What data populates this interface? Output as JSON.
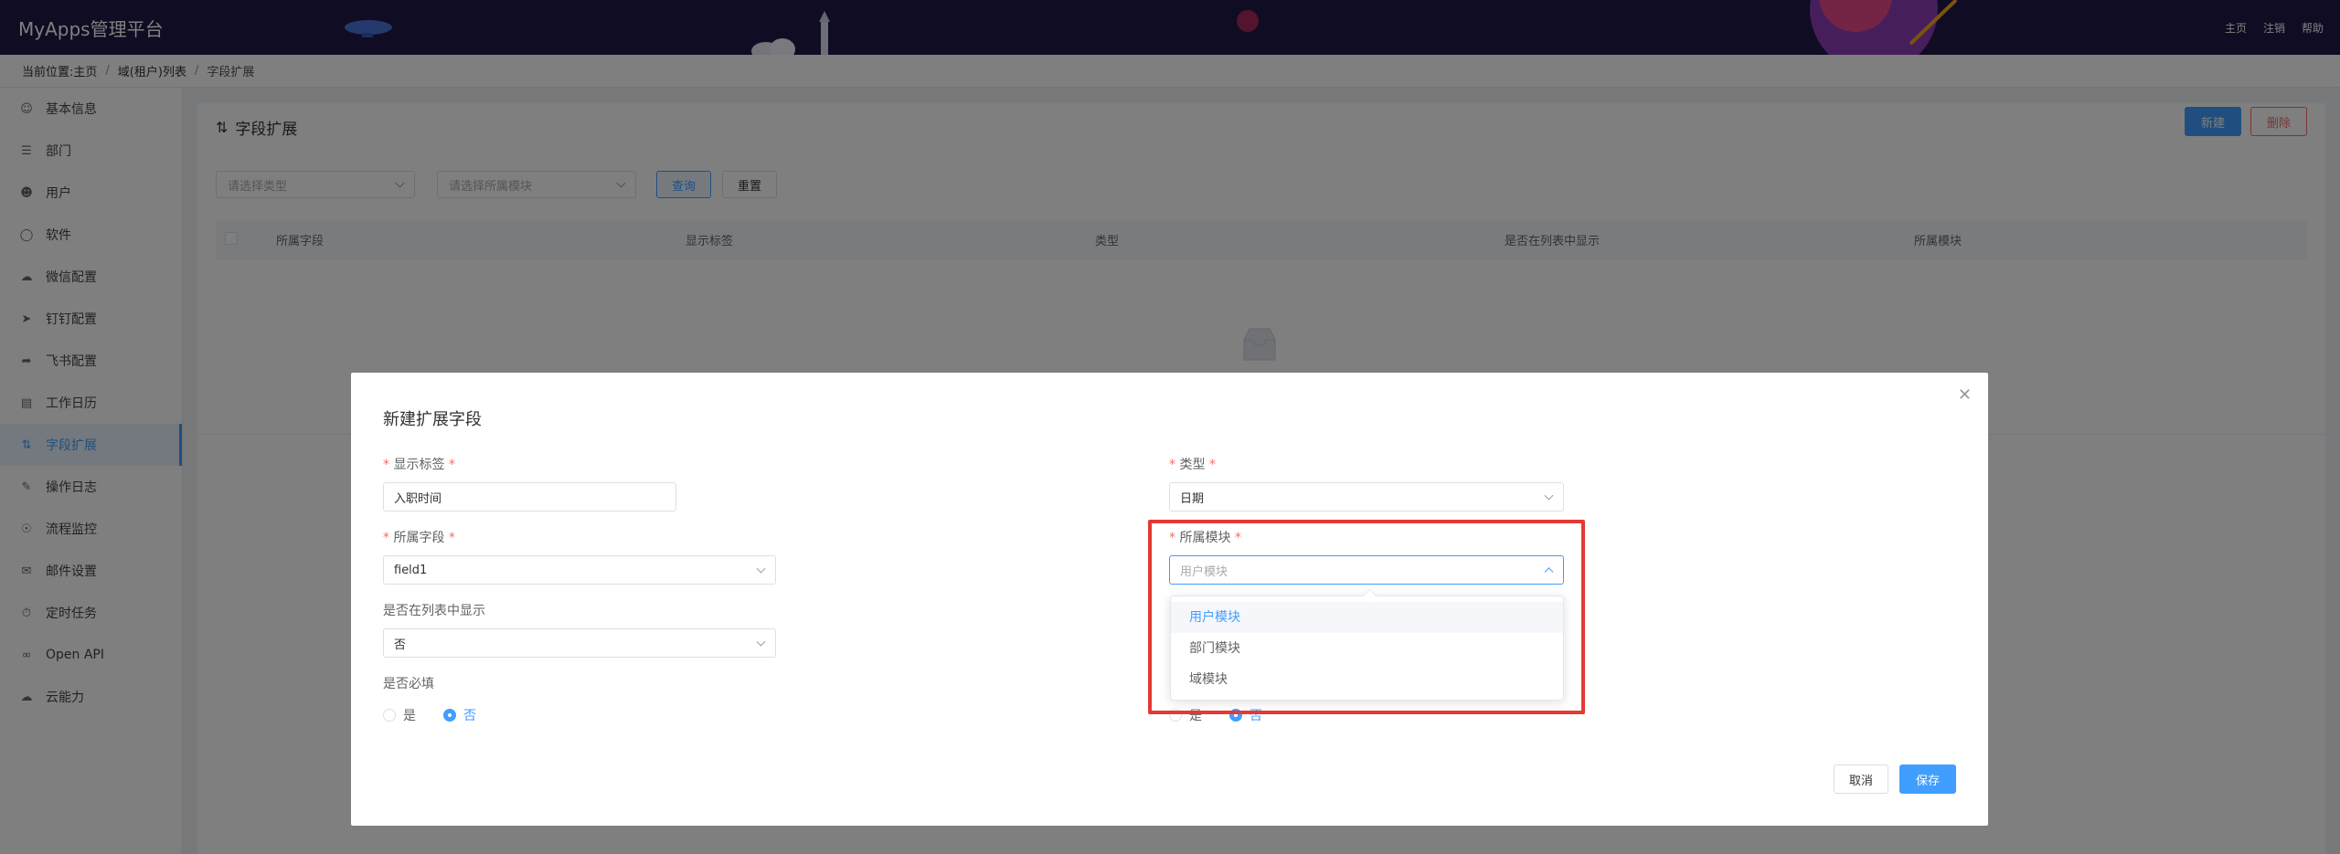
{
  "app": {
    "title": "MyApps管理平台"
  },
  "topnav": {
    "home": "主页",
    "logout": "注销",
    "help": "帮助"
  },
  "breadcrumb": {
    "prefix": "当前位置:",
    "home": "主页",
    "level2": "域(租户)列表",
    "current": "字段扩展"
  },
  "sidebar": {
    "items": [
      {
        "label": "基本信息",
        "icon": "user-icon"
      },
      {
        "label": "部门",
        "icon": "org-icon"
      },
      {
        "label": "用户",
        "icon": "users-icon"
      },
      {
        "label": "软件",
        "icon": "software-icon"
      },
      {
        "label": "微信配置",
        "icon": "wechat-icon"
      },
      {
        "label": "钉钉配置",
        "icon": "dingtalk-icon"
      },
      {
        "label": "飞书配置",
        "icon": "feishu-icon"
      },
      {
        "label": "工作日历",
        "icon": "calendar-icon"
      },
      {
        "label": "字段扩展",
        "icon": "sliders-icon",
        "active": true
      },
      {
        "label": "操作日志",
        "icon": "log-icon"
      },
      {
        "label": "流程监控",
        "icon": "monitor-icon"
      },
      {
        "label": "邮件设置",
        "icon": "mail-icon"
      },
      {
        "label": "定时任务",
        "icon": "timer-icon"
      },
      {
        "label": "Open API",
        "icon": "link-icon"
      },
      {
        "label": "云能力",
        "icon": "cloud-icon"
      }
    ]
  },
  "panel": {
    "title": "字段扩展",
    "new_label": "新建",
    "delete_label": "删除",
    "filter": {
      "type_placeholder": "请选择类型",
      "module_placeholder": "请选择所属模块",
      "query_label": "查询",
      "reset_label": "重置"
    },
    "table": {
      "columns": [
        "所属字段",
        "显示标签",
        "类型",
        "是否在列表中显示",
        "所属模块"
      ]
    }
  },
  "dialog": {
    "title": "新建扩展字段",
    "display_label": {
      "label": "显示标签",
      "value": "入职时间"
    },
    "type": {
      "label": "类型",
      "value": "日期"
    },
    "field": {
      "label": "所属字段",
      "value": "field1"
    },
    "module": {
      "label": "所属模块",
      "placeholder": "用户模块"
    },
    "show_in_list": {
      "label": "是否在列表中显示",
      "value": "否"
    },
    "required": {
      "label": "是否必填",
      "yes": "是",
      "no": "否"
    },
    "right_radio": {
      "yes": "是",
      "no": "否"
    },
    "cancel_label": "取消",
    "save_label": "保存"
  },
  "dropdown": {
    "options": [
      "用户模块",
      "部门模块",
      "域模块"
    ],
    "selected": "用户模块"
  },
  "colors": {
    "primary": "#409eff",
    "danger": "#f56c6c",
    "topbar": "#1e1946",
    "highlight": "#e53935"
  }
}
